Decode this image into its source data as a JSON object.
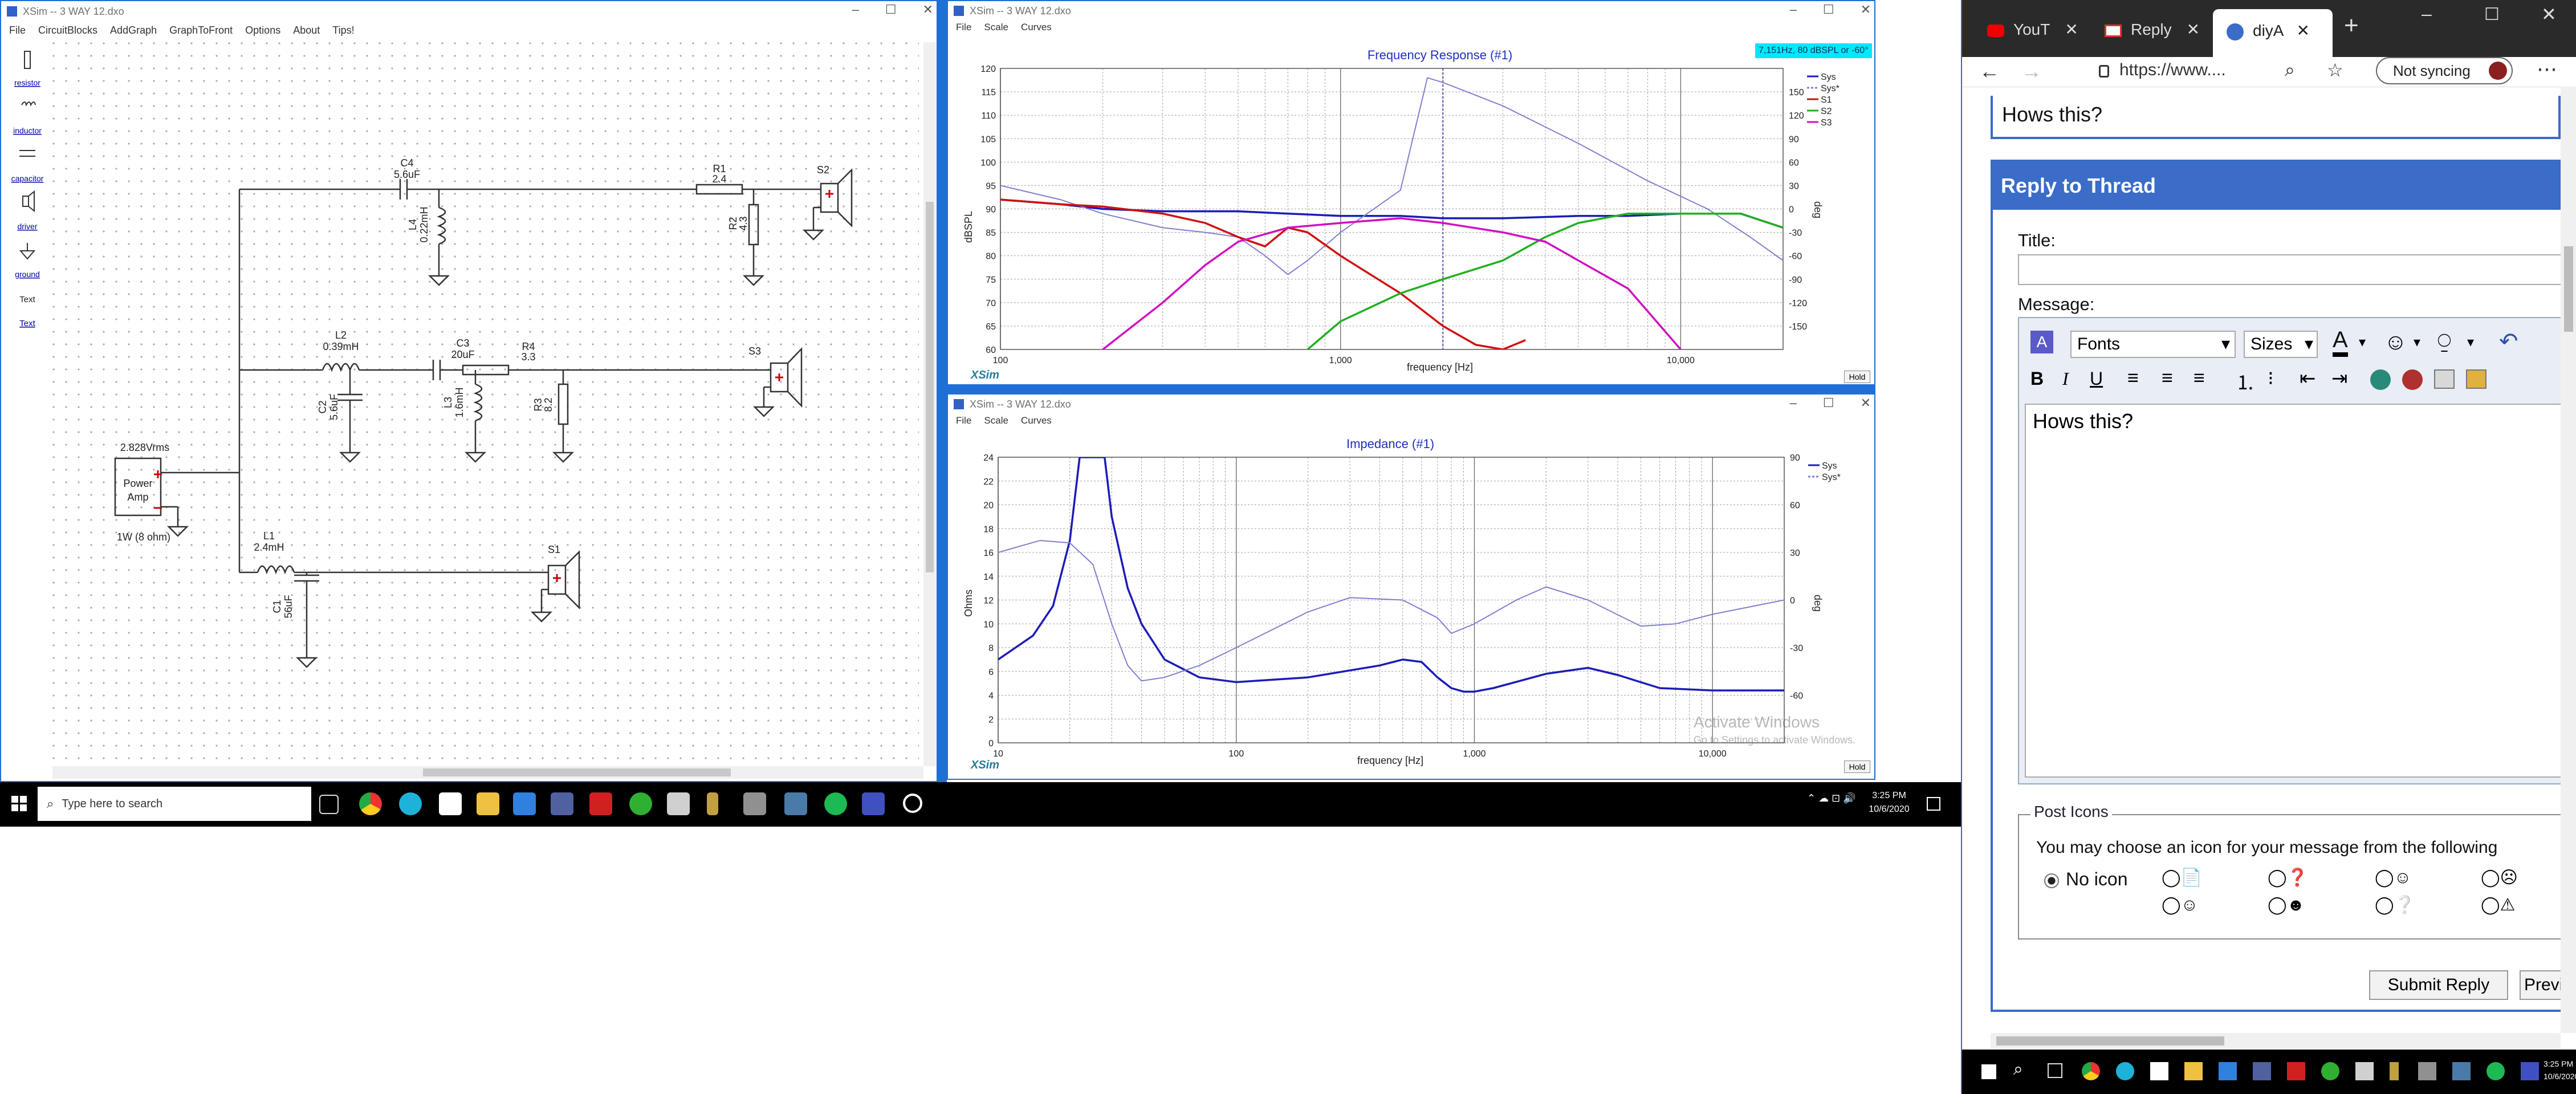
{
  "xsim_circuit": {
    "title": "XSim -- 3 WAY 12.dxo",
    "menu": [
      "File",
      "CircuitBlocks",
      "AddGraph",
      "GraphToFront",
      "Options",
      "About",
      "Tips!"
    ],
    "palette": [
      "resistor",
      "inductor",
      "capacitor",
      "driver",
      "ground",
      "Text",
      "Text"
    ],
    "source": {
      "voltage": "2.828Vrms",
      "label1": "Power",
      "label2": "Amp",
      "rating": "1W (8 ohm)"
    },
    "components": {
      "c4": {
        "name": "C4",
        "value": "5.6uF"
      },
      "l4": {
        "name": "L4",
        "value": "0.22mH"
      },
      "r1": {
        "name": "R1",
        "value": "2.4"
      },
      "r2": {
        "name": "R2",
        "value": "4.3"
      },
      "s2": "S2",
      "l2": {
        "name": "L2",
        "value": "0.39mH"
      },
      "c2": {
        "name": "C2",
        "value": "5.6uF"
      },
      "c3": {
        "name": "C3",
        "value": "20uF"
      },
      "r4": {
        "name": "R4",
        "value": "3.3"
      },
      "l3": {
        "name": "L3",
        "value": "1.6mH"
      },
      "r3": {
        "name": "R3",
        "value": "8.2"
      },
      "s3": "S3",
      "l1": {
        "name": "L1",
        "value": "2.4mH"
      },
      "c1": {
        "name": "C1",
        "value": "56uF"
      },
      "s1": "S1"
    }
  },
  "freq_window": {
    "title": "XSim -- 3 WAY 12.dxo",
    "menu": [
      "File",
      "Scale",
      "Curves"
    ],
    "readout": "7,151Hz, 80 dBSPL or -60°",
    "hold": "Hold",
    "brand": "XSim"
  },
  "imp_window": {
    "title": "XSim -- 3 WAY 12.dxo",
    "menu": [
      "File",
      "Scale",
      "Curves"
    ],
    "hold": "Hold",
    "brand": "XSim",
    "watermark1": "Activate Windows",
    "watermark2": "Go to Settings to activate Windows."
  },
  "chart_data": [
    {
      "type": "line",
      "title": "Frequency Response (#1)",
      "xlabel": "frequency [Hz]",
      "ylabel": "dBSPL",
      "y2label": "deg",
      "xscale": "log",
      "xlim": [
        100,
        20000
      ],
      "ylim": [
        60,
        120
      ],
      "y2lim": [
        -180,
        180
      ],
      "xticks": [
        "100",
        "1,000",
        "10,000"
      ],
      "yticks": [
        60,
        65,
        70,
        75,
        80,
        85,
        90,
        95,
        100,
        105,
        110,
        115,
        120
      ],
      "y2ticks": [
        150,
        120,
        90,
        60,
        30,
        0,
        -30,
        -60,
        -90,
        -120,
        -150
      ],
      "grid": true,
      "legend_position": "top-right",
      "cursor_x": 2000,
      "series": [
        {
          "name": "Sys",
          "color": "#1c1cb8",
          "x": [
            100,
            150,
            200,
            300,
            500,
            700,
            1000,
            1500,
            2000,
            3000,
            5000,
            7000,
            10000,
            15000,
            20000
          ],
          "y": [
            92,
            91,
            90,
            89.5,
            89.5,
            89,
            88.5,
            88.5,
            88,
            88,
            88.5,
            88.5,
            89,
            89,
            86
          ]
        },
        {
          "name": "Sys*",
          "color": "#8080d0",
          "x": [
            100,
            150,
            200,
            300,
            400,
            500,
            600,
            700,
            800,
            1000,
            1500,
            1800,
            2000,
            3000,
            5000,
            8000,
            12000,
            16000,
            20000
          ],
          "y": [
            95,
            92,
            89,
            86,
            85,
            84,
            80,
            76,
            79,
            85,
            94,
            118,
            117,
            112,
            104,
            96,
            90,
            84,
            79
          ]
        },
        {
          "name": "S1",
          "color": "#d01010",
          "x": [
            100,
            150,
            200,
            300,
            400,
            500,
            600,
            700,
            800,
            1000,
            1500,
            2000,
            2500,
            3000,
            3500
          ],
          "y": [
            92,
            91,
            90.5,
            89,
            87,
            84,
            82,
            86,
            85,
            80,
            72,
            65,
            61,
            60,
            62
          ]
        },
        {
          "name": "S2",
          "color": "#20b020",
          "x": [
            800,
            1000,
            1500,
            2000,
            3000,
            4000,
            5000,
            7000,
            10000,
            15000,
            20000
          ],
          "y": [
            60,
            66,
            72,
            75,
            79,
            84,
            87,
            89,
            89,
            89,
            86
          ]
        },
        {
          "name": "S3",
          "color": "#d010c0",
          "x": [
            200,
            300,
            400,
            500,
            700,
            1000,
            1500,
            2000,
            3000,
            4000,
            5000,
            7000,
            10000
          ],
          "y": [
            60,
            70,
            78,
            83,
            86,
            87,
            88,
            87,
            85,
            83,
            79,
            73,
            60
          ]
        }
      ]
    },
    {
      "type": "line",
      "title": "Impedance (#1)",
      "xlabel": "frequency [Hz]",
      "ylabel": "Ohms",
      "y2label": "deg",
      "xscale": "log",
      "xlim": [
        10,
        20000
      ],
      "ylim": [
        0,
        24
      ],
      "y2lim": [
        -90,
        90
      ],
      "xticks": [
        "10",
        "100",
        "1,000",
        "10,000"
      ],
      "yticks": [
        0,
        2,
        4,
        6,
        8,
        10,
        12,
        14,
        16,
        18,
        20,
        22,
        24
      ],
      "y2ticks": [
        90,
        60,
        30,
        0,
        -30,
        -60
      ],
      "grid": true,
      "legend_position": "top-right",
      "series": [
        {
          "name": "Sys",
          "color": "#1c1cb8",
          "x": [
            10,
            14,
            17,
            20,
            22,
            25,
            28,
            30,
            35,
            40,
            50,
            70,
            100,
            200,
            400,
            500,
            600,
            700,
            800,
            900,
            1000,
            1200,
            2000,
            3000,
            4000,
            6000,
            10000,
            20000
          ],
          "y": [
            7,
            9,
            11.5,
            17,
            24,
            24,
            24,
            19,
            13,
            10,
            7,
            5.5,
            5.1,
            5.5,
            6.5,
            7,
            6.8,
            5.5,
            4.6,
            4.3,
            4.3,
            4.6,
            5.8,
            6.3,
            5.7,
            4.6,
            4.4,
            4.4
          ]
        },
        {
          "name": "Sys*",
          "color": "#8080d0",
          "x": [
            10,
            15,
            20,
            25,
            30,
            35,
            40,
            50,
            70,
            100,
            200,
            300,
            500,
            700,
            800,
            1000,
            1500,
            2000,
            3000,
            5000,
            7000,
            10000,
            20000
          ],
          "y": [
            16,
            17,
            16.8,
            15,
            10,
            6.5,
            5.2,
            5.5,
            6.5,
            8,
            11,
            12.2,
            12,
            10.5,
            9.2,
            10,
            12,
            13.1,
            12,
            9.8,
            10,
            10.8,
            12
          ]
        }
      ]
    }
  ],
  "browser": {
    "tabs": [
      "YouT",
      "Reply",
      "diyA"
    ],
    "url": "https://www....",
    "sync": "Not syncing",
    "prev_post": "Hows this?",
    "reply_header": "Reply to Thread",
    "title_label": "Title:",
    "message_label": "Message:",
    "font_select": "Fonts",
    "size_select": "Sizes",
    "message_text": "Hows this?",
    "post_icons_legend": "Post Icons",
    "post_icons_text": "You may choose an icon for your message from the following",
    "no_icon": "No icon",
    "submit": "Submit Reply",
    "preview": "Previ",
    "taskbar_time": "3:25 PM",
    "taskbar_date": "10/6/2020"
  },
  "taskbar": {
    "search_placeholder": "Type here to search",
    "time": "3:25 PM",
    "date": "10/6/2020"
  }
}
